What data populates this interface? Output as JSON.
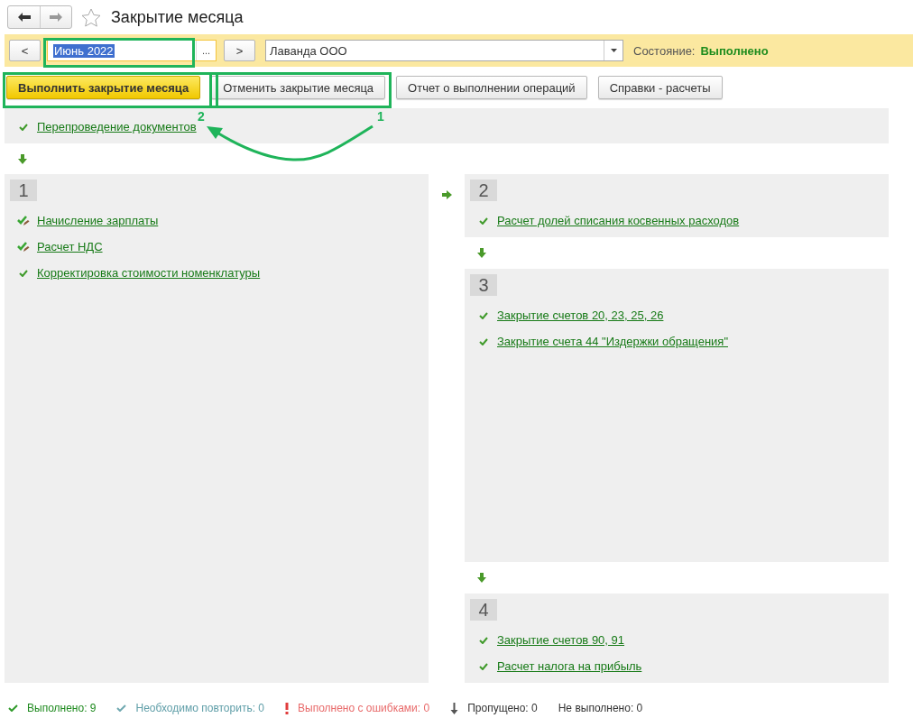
{
  "window": {
    "title": "Закрытие месяца",
    "favorite": false
  },
  "period_bar": {
    "prev": "<",
    "period": "Июнь 2022",
    "period_selected": true,
    "choose": "...",
    "next": ">",
    "organization": "Лаванда ООО",
    "state_label": "Состояние:",
    "state_value": "Выполнено"
  },
  "actions": [
    {
      "label": "Выполнить закрытие месяца",
      "kind": "primary"
    },
    {
      "label": "Отменить закрытие месяца",
      "kind": "normal"
    },
    {
      "label": "Отчет о выполнении операций",
      "kind": "normal"
    },
    {
      "label": "Справки - расчеты",
      "kind": "normal"
    }
  ],
  "pre_step": {
    "items": [
      {
        "label": "Перепроведение документов",
        "kind": "done"
      }
    ]
  },
  "left_column": [
    {
      "number": "1",
      "items": [
        {
          "label": "Начисление зарплаты",
          "kind": "done_manual"
        },
        {
          "label": "Расчет НДС",
          "kind": "done_manual"
        },
        {
          "label": "Корректировка стоимости номенклатуры",
          "kind": "done"
        }
      ]
    }
  ],
  "right_column": [
    {
      "number": "2",
      "items": [
        {
          "label": "Расчет долей списания косвенных расходов",
          "kind": "done"
        }
      ]
    },
    {
      "number": "3",
      "items": [
        {
          "label": "Закрытие счетов 20, 23, 25, 26",
          "kind": "done"
        },
        {
          "label": "Закрытие счета 44 \"Издержки обращения\"",
          "kind": "done"
        }
      ]
    },
    {
      "number": "4",
      "items": [
        {
          "label": "Закрытие счетов 90, 91",
          "kind": "done"
        },
        {
          "label": "Расчет налога на прибыль",
          "kind": "done"
        }
      ]
    }
  ],
  "status_bar": [
    {
      "kind": "done",
      "text": "Выполнено: 9"
    },
    {
      "kind": "repeat",
      "text": "Необходимо повторить: 0"
    },
    {
      "kind": "error",
      "text": "Выполнено с ошибками: 0"
    },
    {
      "kind": "skipped",
      "text": "Пропущено: 0"
    },
    {
      "kind": "not_done",
      "text": "Не выполнено: 0"
    }
  ],
  "annotations": [
    {
      "label": "2"
    },
    {
      "label": "1"
    }
  ]
}
